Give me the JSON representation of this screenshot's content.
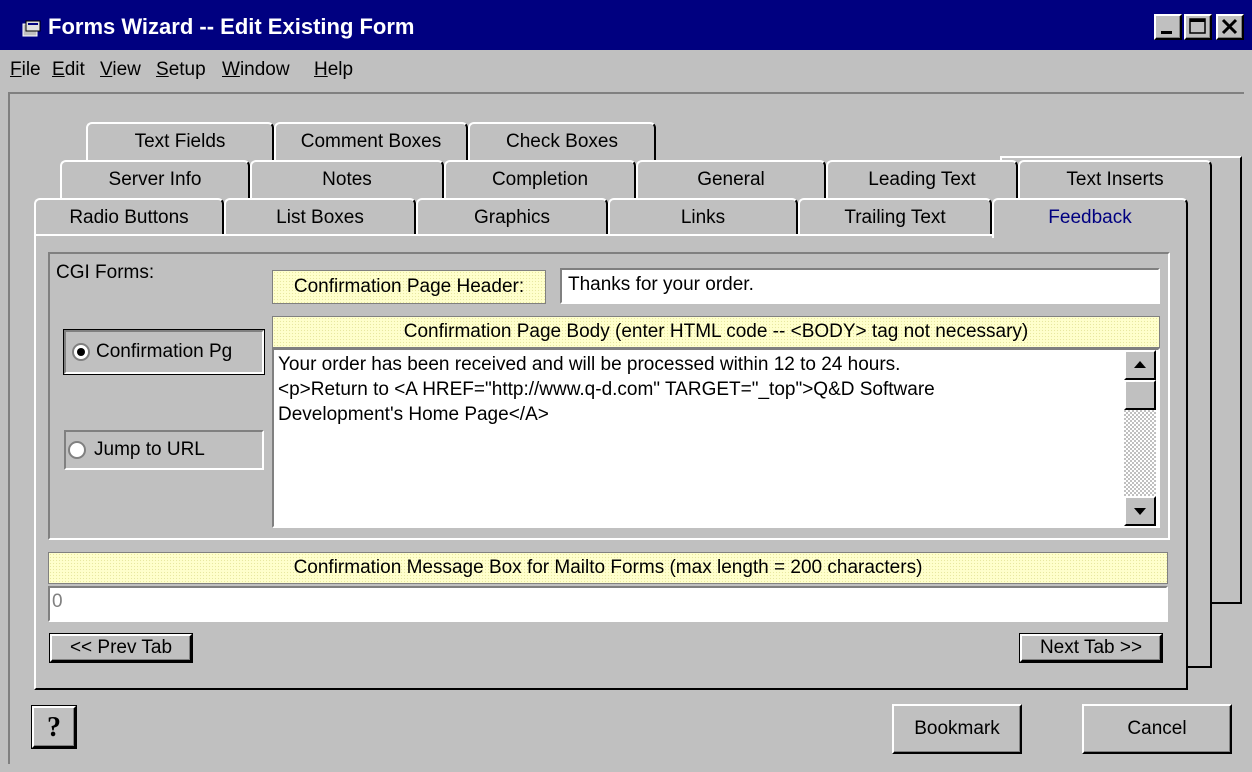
{
  "window": {
    "title": "Forms Wizard -- Edit Existing Form"
  },
  "menu": [
    "File",
    "Edit",
    "View",
    "Setup",
    "Window",
    "Help"
  ],
  "tabs": {
    "row1": [
      "Text Fields",
      "Comment Boxes",
      "Check Boxes"
    ],
    "row2": [
      "Server Info",
      "Notes",
      "Completion",
      "General",
      "Leading Text",
      "Text Inserts"
    ],
    "row3": [
      "Radio Buttons",
      "List Boxes",
      "Graphics",
      "Links",
      "Trailing Text",
      "Feedback"
    ],
    "active": "Feedback"
  },
  "feedback": {
    "cgi_forms_label": "CGI Forms:",
    "radio_confirmation_label": "Confirmation Pg",
    "radio_confirmation_checked": true,
    "radio_jump_label": "Jump to URL",
    "radio_jump_checked": false,
    "header_label": "Confirmation Page Header:",
    "header_value": "Thanks for your order.",
    "body_label": "Confirmation Page Body (enter HTML code -- <BODY> tag not necessary)",
    "body_value": "Your order has been received and will be processed within 12 to 24 hours.\n<p>Return to <A HREF=\"http://www.q-d.com\" TARGET=\"_top\">Q&D Software\nDevelopment's Home Page</A>",
    "mailto_label": "Confirmation Message Box for Mailto Forms (max length = 200 characters)",
    "mailto_value": "0"
  },
  "nav": {
    "prev": "<< Prev Tab",
    "next": "Next Tab >>"
  },
  "footer": {
    "help_icon": "?",
    "bookmark": "Bookmark",
    "cancel": "Cancel"
  }
}
